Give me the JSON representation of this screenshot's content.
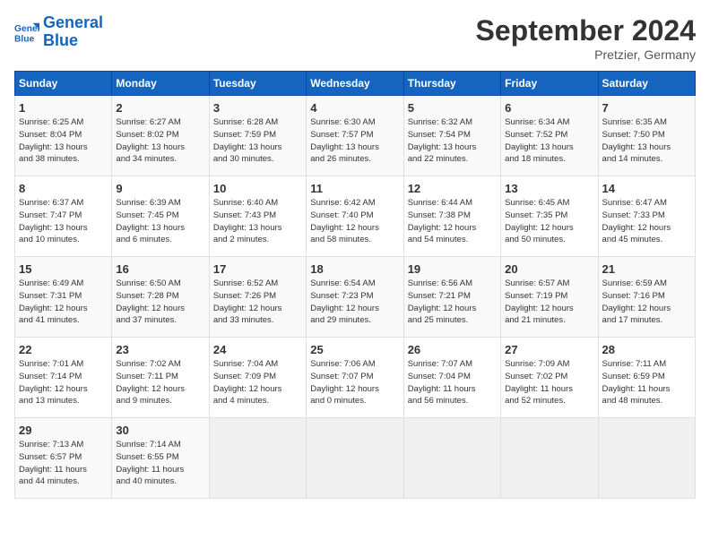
{
  "header": {
    "logo_line1": "General",
    "logo_line2": "Blue",
    "month": "September 2024",
    "location": "Pretzier, Germany"
  },
  "weekdays": [
    "Sunday",
    "Monday",
    "Tuesday",
    "Wednesday",
    "Thursday",
    "Friday",
    "Saturday"
  ],
  "weeks": [
    [
      {
        "day": "1",
        "info": "Sunrise: 6:25 AM\nSunset: 8:04 PM\nDaylight: 13 hours\nand 38 minutes."
      },
      {
        "day": "2",
        "info": "Sunrise: 6:27 AM\nSunset: 8:02 PM\nDaylight: 13 hours\nand 34 minutes."
      },
      {
        "day": "3",
        "info": "Sunrise: 6:28 AM\nSunset: 7:59 PM\nDaylight: 13 hours\nand 30 minutes."
      },
      {
        "day": "4",
        "info": "Sunrise: 6:30 AM\nSunset: 7:57 PM\nDaylight: 13 hours\nand 26 minutes."
      },
      {
        "day": "5",
        "info": "Sunrise: 6:32 AM\nSunset: 7:54 PM\nDaylight: 13 hours\nand 22 minutes."
      },
      {
        "day": "6",
        "info": "Sunrise: 6:34 AM\nSunset: 7:52 PM\nDaylight: 13 hours\nand 18 minutes."
      },
      {
        "day": "7",
        "info": "Sunrise: 6:35 AM\nSunset: 7:50 PM\nDaylight: 13 hours\nand 14 minutes."
      }
    ],
    [
      {
        "day": "8",
        "info": "Sunrise: 6:37 AM\nSunset: 7:47 PM\nDaylight: 13 hours\nand 10 minutes."
      },
      {
        "day": "9",
        "info": "Sunrise: 6:39 AM\nSunset: 7:45 PM\nDaylight: 13 hours\nand 6 minutes."
      },
      {
        "day": "10",
        "info": "Sunrise: 6:40 AM\nSunset: 7:43 PM\nDaylight: 13 hours\nand 2 minutes."
      },
      {
        "day": "11",
        "info": "Sunrise: 6:42 AM\nSunset: 7:40 PM\nDaylight: 12 hours\nand 58 minutes."
      },
      {
        "day": "12",
        "info": "Sunrise: 6:44 AM\nSunset: 7:38 PM\nDaylight: 12 hours\nand 54 minutes."
      },
      {
        "day": "13",
        "info": "Sunrise: 6:45 AM\nSunset: 7:35 PM\nDaylight: 12 hours\nand 50 minutes."
      },
      {
        "day": "14",
        "info": "Sunrise: 6:47 AM\nSunset: 7:33 PM\nDaylight: 12 hours\nand 45 minutes."
      }
    ],
    [
      {
        "day": "15",
        "info": "Sunrise: 6:49 AM\nSunset: 7:31 PM\nDaylight: 12 hours\nand 41 minutes."
      },
      {
        "day": "16",
        "info": "Sunrise: 6:50 AM\nSunset: 7:28 PM\nDaylight: 12 hours\nand 37 minutes."
      },
      {
        "day": "17",
        "info": "Sunrise: 6:52 AM\nSunset: 7:26 PM\nDaylight: 12 hours\nand 33 minutes."
      },
      {
        "day": "18",
        "info": "Sunrise: 6:54 AM\nSunset: 7:23 PM\nDaylight: 12 hours\nand 29 minutes."
      },
      {
        "day": "19",
        "info": "Sunrise: 6:56 AM\nSunset: 7:21 PM\nDaylight: 12 hours\nand 25 minutes."
      },
      {
        "day": "20",
        "info": "Sunrise: 6:57 AM\nSunset: 7:19 PM\nDaylight: 12 hours\nand 21 minutes."
      },
      {
        "day": "21",
        "info": "Sunrise: 6:59 AM\nSunset: 7:16 PM\nDaylight: 12 hours\nand 17 minutes."
      }
    ],
    [
      {
        "day": "22",
        "info": "Sunrise: 7:01 AM\nSunset: 7:14 PM\nDaylight: 12 hours\nand 13 minutes."
      },
      {
        "day": "23",
        "info": "Sunrise: 7:02 AM\nSunset: 7:11 PM\nDaylight: 12 hours\nand 9 minutes."
      },
      {
        "day": "24",
        "info": "Sunrise: 7:04 AM\nSunset: 7:09 PM\nDaylight: 12 hours\nand 4 minutes."
      },
      {
        "day": "25",
        "info": "Sunrise: 7:06 AM\nSunset: 7:07 PM\nDaylight: 12 hours\nand 0 minutes."
      },
      {
        "day": "26",
        "info": "Sunrise: 7:07 AM\nSunset: 7:04 PM\nDaylight: 11 hours\nand 56 minutes."
      },
      {
        "day": "27",
        "info": "Sunrise: 7:09 AM\nSunset: 7:02 PM\nDaylight: 11 hours\nand 52 minutes."
      },
      {
        "day": "28",
        "info": "Sunrise: 7:11 AM\nSunset: 6:59 PM\nDaylight: 11 hours\nand 48 minutes."
      }
    ],
    [
      {
        "day": "29",
        "info": "Sunrise: 7:13 AM\nSunset: 6:57 PM\nDaylight: 11 hours\nand 44 minutes."
      },
      {
        "day": "30",
        "info": "Sunrise: 7:14 AM\nSunset: 6:55 PM\nDaylight: 11 hours\nand 40 minutes."
      },
      {
        "day": "",
        "info": ""
      },
      {
        "day": "",
        "info": ""
      },
      {
        "day": "",
        "info": ""
      },
      {
        "day": "",
        "info": ""
      },
      {
        "day": "",
        "info": ""
      }
    ]
  ]
}
